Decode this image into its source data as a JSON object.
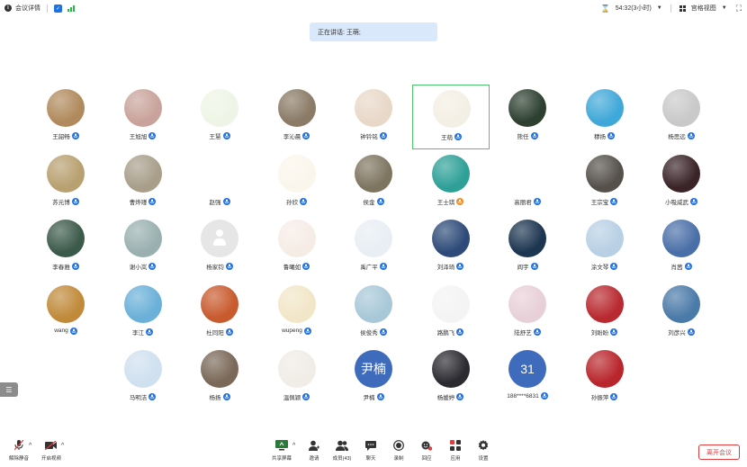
{
  "topbar": {
    "meeting_details": "会议详情",
    "timer": "54:32(3小时)",
    "view_mode": "宫格视图"
  },
  "speaker_banner": "正在讲话: 王萌;",
  "participants": [
    {
      "name": "王韶畅",
      "avatar": "photo-lake-sunset",
      "color": "#b08a5c",
      "mic": "blue"
    },
    {
      "name": "王旭旭",
      "avatar": "photo-cartoon-boy",
      "color": "#c9a39b",
      "mic": "blue"
    },
    {
      "name": "王慧",
      "avatar": "photo-green-leaf",
      "color": "#eef5e6",
      "mic": "blue"
    },
    {
      "name": "李沁晨",
      "avatar": "photo-elderly-man",
      "color": "#8a7a66",
      "mic": "blue"
    },
    {
      "name": "钟钤铭",
      "avatar": "photo-cartoon-girl",
      "color": "#e8d8c8",
      "mic": "blue"
    },
    {
      "name": "王萌",
      "avatar": "photo-cartoon-cat",
      "color": "#f4efe4",
      "mic": "blue",
      "active": true
    },
    {
      "name": "熊任",
      "avatar": "photo-basketball",
      "color": "#2d4030",
      "mic": "blue"
    },
    {
      "name": "穆扬",
      "avatar": "photo-cartoon-student",
      "color": "#3fa8d8",
      "mic": "blue"
    },
    {
      "name": "杨思远",
      "avatar": "photo-tiger",
      "color": "#c9c9c9",
      "mic": "blue"
    },
    {
      "name": "苏元博",
      "avatar": "photo-man-lying",
      "color": "#b8a070",
      "mic": "blue"
    },
    {
      "name": "曹烨瑾",
      "avatar": "photo-misty-field",
      "color": "#a89e8a",
      "mic": "blue"
    },
    {
      "name": "赵强",
      "avatar": "photo-calligraphy",
      "color": "#ffffff",
      "mic": "blue"
    },
    {
      "name": "孙欣",
      "avatar": "photo-cartoon-doodle",
      "color": "#fbf6ec",
      "mic": "blue"
    },
    {
      "name": "侯金",
      "avatar": "photo-couple-sunset",
      "color": "#7e7560",
      "mic": "blue"
    },
    {
      "name": "王士琪",
      "avatar": "photo-reading-girl",
      "color": "#2ea098",
      "mic": "orange"
    },
    {
      "name": "高丽君",
      "avatar": "photo-sketch-face",
      "color": "#ffffff",
      "mic": "blue"
    },
    {
      "name": "王宗宝",
      "avatar": "photo-portrait-man",
      "color": "#55504a",
      "mic": "blue"
    },
    {
      "name": "小吸威武",
      "avatar": "photo-dark-portrait",
      "color": "#3a2428",
      "mic": "blue"
    },
    {
      "name": "李春雅",
      "avatar": "photo-forest-light",
      "color": "#3c5a4a",
      "mic": "blue"
    },
    {
      "name": "谢小岚",
      "avatar": "photo-lake-ships",
      "color": "#9ab0b0",
      "mic": "blue"
    },
    {
      "name": "杨家钧",
      "avatar": "photo-default",
      "color": "#e6e6e6",
      "mic": "blue"
    },
    {
      "name": "鲁曦如",
      "avatar": "photo-cartoon-hat-girl",
      "color": "#f6ece6",
      "mic": "blue"
    },
    {
      "name": "禹广平",
      "avatar": "photo-girl-white",
      "color": "#e8eef4",
      "mic": "blue"
    },
    {
      "name": "刘泽琦",
      "avatar": "photo-sunset-sea",
      "color": "#2d4a78",
      "mic": "blue"
    },
    {
      "name": "阎宇",
      "avatar": "photo-night-sky-girl",
      "color": "#1c3550",
      "mic": "blue"
    },
    {
      "name": "涂文琴",
      "avatar": "photo-beach-girl",
      "color": "#b8d0e4",
      "mic": "blue"
    },
    {
      "name": "肖茜",
      "avatar": "photo-blue-sky",
      "color": "#4a6fa8",
      "mic": "blue"
    },
    {
      "name": "wang",
      "avatar": "photo-autumn-trees",
      "color": "#c08a3a",
      "mic": "blue"
    },
    {
      "name": "李江",
      "avatar": "photo-rainbow",
      "color": "#6ab0d8",
      "mic": "blue"
    },
    {
      "name": "杜同阳",
      "avatar": "photo-cartoon-tiger-kid",
      "color": "#c85a2e",
      "mic": "blue"
    },
    {
      "name": "wupeng",
      "avatar": "photo-crayon-shin",
      "color": "#f2e6c8",
      "mic": "blue"
    },
    {
      "name": "侯俊秀",
      "avatar": "photo-bokeh-field",
      "color": "#a8c8d8",
      "mic": "blue"
    },
    {
      "name": "路鹏飞",
      "avatar": "photo-sketch-kid",
      "color": "#f4f4f4",
      "mic": "blue"
    },
    {
      "name": "陆舒艺",
      "avatar": "photo-pink-anime",
      "color": "#e8d0d8",
      "mic": "blue"
    },
    {
      "name": "刘盼盼",
      "avatar": "photo-red-anime",
      "color": "#b82a30",
      "mic": "blue"
    },
    {
      "name": "刘彦兴",
      "avatar": "photo-red-umbrella",
      "color": "#4a7aa8",
      "mic": "blue"
    },
    {
      "name": "马明洁",
      "avatar": "photo-cartoon-lady",
      "color": "#cfe0f0",
      "mic": "blue"
    },
    {
      "name": "杨扬",
      "avatar": "photo-hand-glass",
      "color": "#7a6858",
      "mic": "blue"
    },
    {
      "name": "温佩颖",
      "avatar": "photo-cartoon-bears",
      "color": "#f0ece6",
      "mic": "blue"
    },
    {
      "name": "尹楠",
      "avatar_text": "尹楠",
      "color": "#3f6bbd",
      "mic": "blue"
    },
    {
      "name": "杨媛婷",
      "avatar": "photo-dark-moon",
      "color": "#2a2a30",
      "mic": "blue"
    },
    {
      "name": "188****6831",
      "avatar_text": "31",
      "color": "#3f6bbd",
      "mic": "blue"
    },
    {
      "name": "孙振萍",
      "avatar": "photo-red-anime-2",
      "color": "#b8262c",
      "mic": "blue"
    }
  ],
  "toolbar": {
    "unmute": "解除静音",
    "start_video": "开启视频",
    "share_screen": "共享屏幕",
    "invite": "邀请",
    "members": "成员(43)",
    "chat": "聊天",
    "record": "录制",
    "reaction": "回应",
    "apps": "应用",
    "settings": "设置",
    "leave": "离开会议"
  },
  "colors": {
    "accent": "#1f6fe5",
    "active_border": "#4cc56d",
    "leave": "#e03c3c",
    "banner_bg": "#d9e8fb"
  }
}
